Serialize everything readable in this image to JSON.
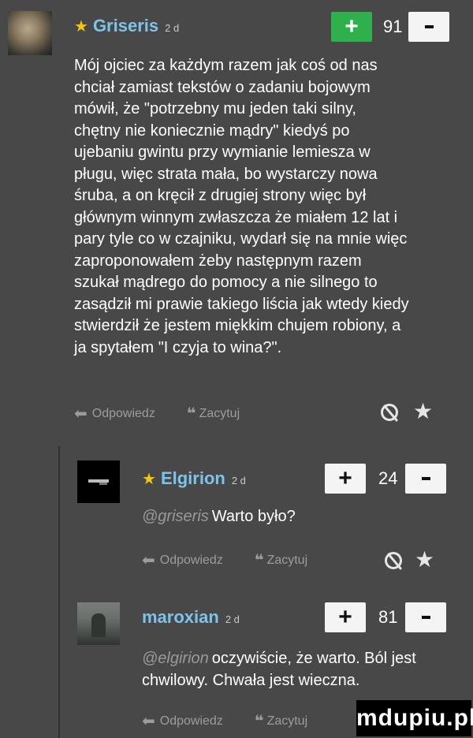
{
  "comments": [
    {
      "author": "Griseris",
      "time": "2 d",
      "featured": true,
      "votes": "91",
      "lines": [
        "Mój ojciec za każdym razem jak coś od nas",
        "chciał zamiast tekstów o zadaniu bojowym",
        "mówił, że \"potrzebny mu jeden taki silny,",
        "chętny nie koniecznie mądry\" kiedyś po",
        "ujebaniu gwintu przy wymianie lemiesza w",
        "pługu, więc strata mała, bo wystarczy nowa",
        "śruba, a on kręcił z drugiej strony więc był",
        "głównym winnym zwłaszcza że miałem 12 lat i",
        "pary tyle co w czajniku, wydarł się na mnie więc",
        "zaproponowałem żeby następnym razem",
        "szukał mądrego do pomocy a nie silnego to",
        "zasądził mi prawie takiego liścia jak wtedy kiedy",
        "stwierdził że jestem miękkim chujem robiony, a",
        "ja spytałem \"I czyja to wina?\"."
      ]
    },
    {
      "author": "Elgirion",
      "time": "2 d",
      "featured": true,
      "votes": "24",
      "mention": "@griseris",
      "lines": [
        "Warto było?"
      ]
    },
    {
      "author": "maroxian",
      "time": "2 d",
      "featured": false,
      "votes": "81",
      "mention": "@elgirion",
      "lines": [
        "oczywiście, że warto. Ból jest",
        "chwilowy. Chwała jest wieczna."
      ]
    }
  ],
  "actions": {
    "reply": "Odpowiedz",
    "quote": "Zacytuj"
  },
  "watermark": "mdupiu.pl",
  "colors": {
    "author": "#7ec3ea",
    "featured_star": "#f3c613",
    "upvoted": "#2eb14d",
    "background": "#484848"
  }
}
